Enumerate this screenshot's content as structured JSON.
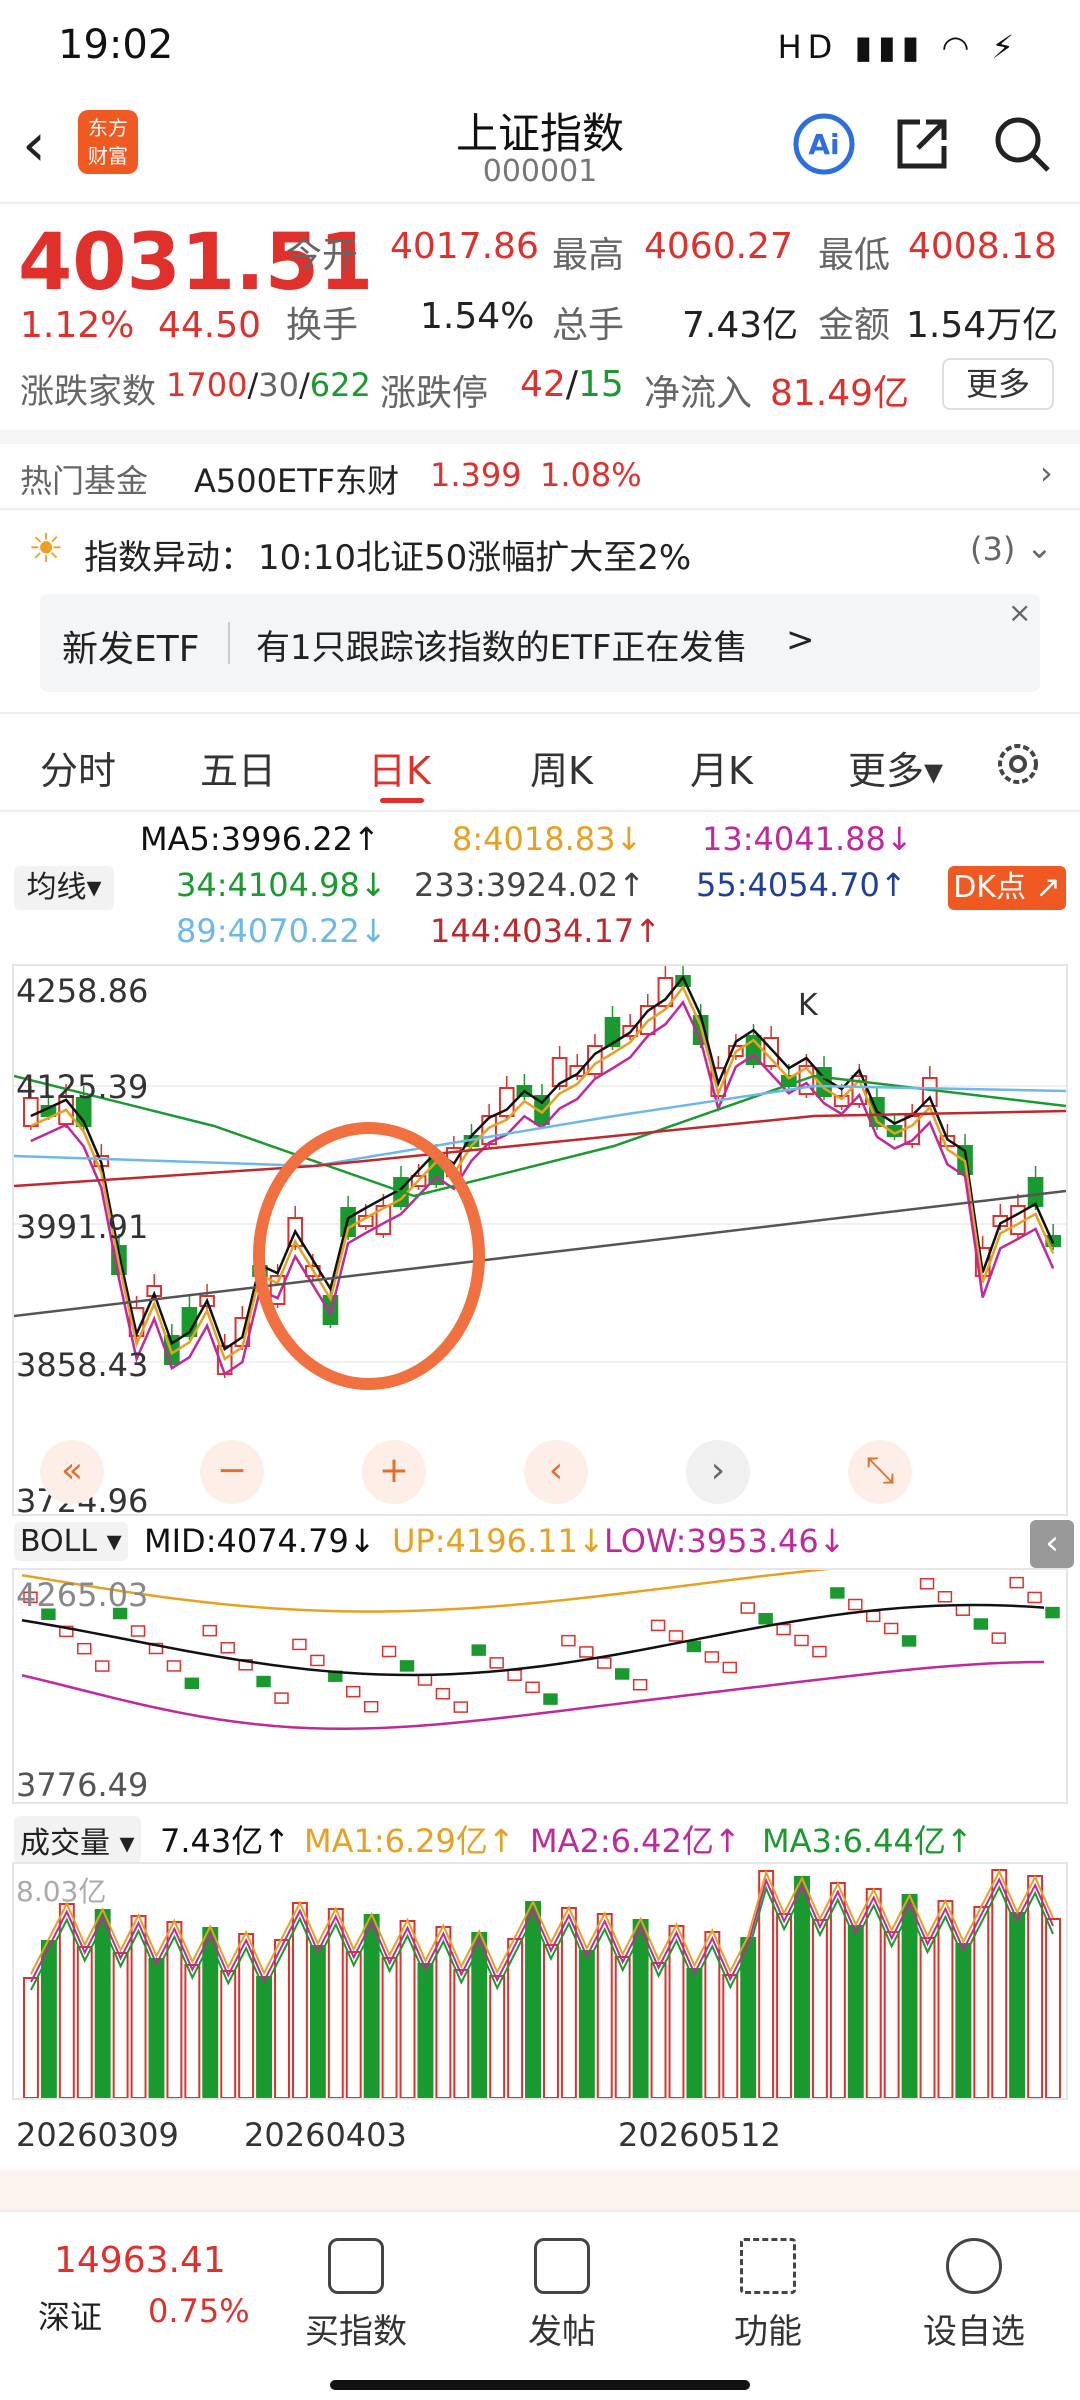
{
  "status": {
    "time": "19:02",
    "icons": "HD ▮▮▮ ◠ ⚡"
  },
  "header": {
    "title": "上证指数",
    "code": "000001",
    "logo_line1": "东方",
    "logo_line2": "财富"
  },
  "quote": {
    "price": "4031.51",
    "pct": "1.12%",
    "change": "44.50",
    "open_label": "今开",
    "open": "4017.86",
    "high_label": "最高",
    "high": "4060.27",
    "low_label": "最低",
    "low": "4008.18",
    "turnover_label": "换手",
    "turnover": "1.54%",
    "volume_label": "总手",
    "volume": "7.43亿",
    "amount_label": "金额",
    "amount": "1.54万亿",
    "breadth_label": "涨跌家数",
    "up": "1700",
    "flat": "30",
    "down": "622",
    "limit_label": "涨跌停",
    "limit_up": "42",
    "limit_down": "15",
    "inflow_label": "净流入",
    "inflow": "81.49亿",
    "more_label": "更多"
  },
  "hotfund": {
    "label": "热门基金",
    "name": "A500ETF东财",
    "price": "1.399",
    "pct": "1.08%"
  },
  "alert": {
    "label": "指数异动：",
    "text": "10:10北证50涨幅扩大至2%",
    "count": "(3)"
  },
  "etf_banner": {
    "tag": "新发ETF",
    "text": "有1只跟踪该指数的ETF正在发售",
    "arrow": ">"
  },
  "tabs": [
    "分时",
    "五日",
    "日K",
    "周K",
    "月K",
    "更多▾"
  ],
  "active_tab": "日K",
  "ma": {
    "selector": "均线▾",
    "ma5": "MA5:3996.22↑",
    "ma8": "8:4018.83↓",
    "ma13": "13:4041.88↓",
    "ma34": "34:4104.98↓",
    "ma233": "233:3924.02↑",
    "ma55": "55:4054.70↑",
    "ma89": "89:4070.22↓",
    "ma144": "144:4034.17↑",
    "dk": "DK点 ↗"
  },
  "kline": {
    "y_top": "4258.86",
    "y_2": "4125.39",
    "y_3": "3991.91",
    "y_4": "3858.43",
    "y_bottom": "3724.96",
    "marker": "K"
  },
  "boll": {
    "selector": "BOLL ▾",
    "mid": "MID:4074.79↓",
    "up": "UP:4196.11↓",
    "low": "LOW:3953.46↓",
    "y_top": "4265.03",
    "y_bottom": "3776.49"
  },
  "vol": {
    "selector": "成交量 ▾",
    "value": "7.43亿↑",
    "ma1": "MA1:6.29亿↑",
    "ma2": "MA2:6.42亿↑",
    "ma3": "MA3:6.44亿↑",
    "y_top": "8.03亿"
  },
  "dates": [
    "20260309",
    "20260403",
    "20260512"
  ],
  "bottom": {
    "index_value": "14963.41",
    "index_name": "深证",
    "index_pct": "0.75%",
    "items": [
      "买指数",
      "发帖",
      "功能",
      "设自选"
    ]
  },
  "colors": {
    "up": "#e0302c",
    "down": "#1a9a2e",
    "accent": "#f05a22"
  }
}
